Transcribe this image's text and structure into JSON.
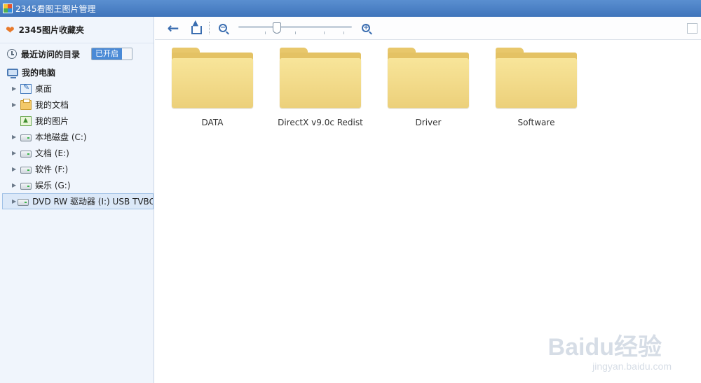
{
  "window": {
    "title": "2345看图王图片管理"
  },
  "sidebar": {
    "favorites_label": "2345图片收藏夹",
    "recent": {
      "label": "最近访问的目录",
      "toggle_label": "已开启"
    },
    "computer_label": "我的电脑",
    "items": [
      {
        "label": "桌面",
        "icon": "desktop-icon",
        "expandable": true
      },
      {
        "label": "我的文档",
        "icon": "documents-folder-icon",
        "expandable": true
      },
      {
        "label": "我的图片",
        "icon": "pictures-icon",
        "expandable": false
      },
      {
        "label": "本地磁盘 (C:)",
        "icon": "drive-icon",
        "expandable": true
      },
      {
        "label": "文档 (E:)",
        "icon": "drive-icon",
        "expandable": true
      },
      {
        "label": "软件 (F:)",
        "icon": "drive-icon",
        "expandable": true
      },
      {
        "label": "娱乐 (G:)",
        "icon": "drive-icon",
        "expandable": true
      },
      {
        "label": "DVD RW 驱动器 (I:) USB TVBOX",
        "icon": "drive-icon",
        "expandable": true,
        "selected": true
      }
    ]
  },
  "toolbar": {
    "zoom_out_symbol": "−",
    "zoom_in_symbol": "+",
    "zoom_level_fraction": 0.34
  },
  "content": {
    "folders": [
      {
        "label": "DATA"
      },
      {
        "label": "DirectX v9.0c Redist"
      },
      {
        "label": "Driver"
      },
      {
        "label": "Software"
      }
    ]
  },
  "watermark": {
    "main": "Baidu经验",
    "sub": "jingyan.baidu.com"
  },
  "colors": {
    "titlebar": "#4a82c8",
    "folder": "#f3dc88",
    "accent": "#3a6db0",
    "selected": "#dbe8f8"
  }
}
